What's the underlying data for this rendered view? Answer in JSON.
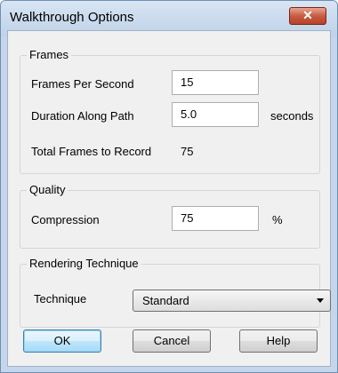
{
  "window": {
    "title": "Walkthrough Options",
    "close_symbol": "✕"
  },
  "frames": {
    "group_label": "Frames",
    "fps_label": "Frames Per Second",
    "fps_value": "15",
    "duration_label": "Duration Along Path",
    "duration_value": "5.0",
    "duration_unit": "seconds",
    "total_label": "Total Frames to Record",
    "total_value": "75"
  },
  "quality": {
    "group_label": "Quality",
    "compression_label": "Compression",
    "compression_value": "75",
    "compression_unit": "%"
  },
  "rendering": {
    "group_label": "Rendering Technique",
    "technique_label": "Technique",
    "technique_selected": "Standard"
  },
  "buttons": {
    "ok": "OK",
    "cancel": "Cancel",
    "help": "Help"
  }
}
